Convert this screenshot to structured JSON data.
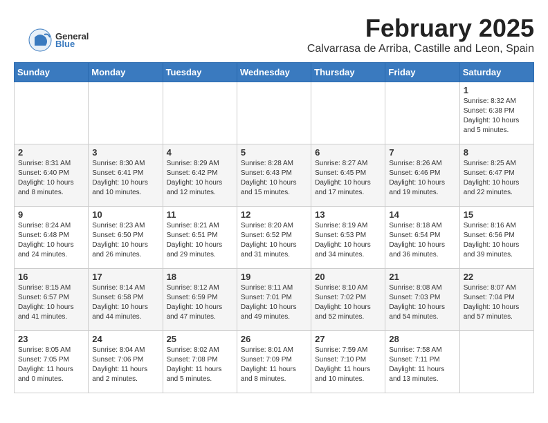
{
  "logo": {
    "general": "General",
    "blue": "Blue"
  },
  "header": {
    "month_year": "February 2025",
    "location": "Calvarrasa de Arriba, Castille and Leon, Spain"
  },
  "weekdays": [
    "Sunday",
    "Monday",
    "Tuesday",
    "Wednesday",
    "Thursday",
    "Friday",
    "Saturday"
  ],
  "weeks": [
    {
      "days": [
        {
          "num": "",
          "info": ""
        },
        {
          "num": "",
          "info": ""
        },
        {
          "num": "",
          "info": ""
        },
        {
          "num": "",
          "info": ""
        },
        {
          "num": "",
          "info": ""
        },
        {
          "num": "",
          "info": ""
        },
        {
          "num": "1",
          "info": "Sunrise: 8:32 AM\nSunset: 6:38 PM\nDaylight: 10 hours and 5 minutes."
        }
      ]
    },
    {
      "days": [
        {
          "num": "2",
          "info": "Sunrise: 8:31 AM\nSunset: 6:40 PM\nDaylight: 10 hours and 8 minutes."
        },
        {
          "num": "3",
          "info": "Sunrise: 8:30 AM\nSunset: 6:41 PM\nDaylight: 10 hours and 10 minutes."
        },
        {
          "num": "4",
          "info": "Sunrise: 8:29 AM\nSunset: 6:42 PM\nDaylight: 10 hours and 12 minutes."
        },
        {
          "num": "5",
          "info": "Sunrise: 8:28 AM\nSunset: 6:43 PM\nDaylight: 10 hours and 15 minutes."
        },
        {
          "num": "6",
          "info": "Sunrise: 8:27 AM\nSunset: 6:45 PM\nDaylight: 10 hours and 17 minutes."
        },
        {
          "num": "7",
          "info": "Sunrise: 8:26 AM\nSunset: 6:46 PM\nDaylight: 10 hours and 19 minutes."
        },
        {
          "num": "8",
          "info": "Sunrise: 8:25 AM\nSunset: 6:47 PM\nDaylight: 10 hours and 22 minutes."
        }
      ]
    },
    {
      "days": [
        {
          "num": "9",
          "info": "Sunrise: 8:24 AM\nSunset: 6:48 PM\nDaylight: 10 hours and 24 minutes."
        },
        {
          "num": "10",
          "info": "Sunrise: 8:23 AM\nSunset: 6:50 PM\nDaylight: 10 hours and 26 minutes."
        },
        {
          "num": "11",
          "info": "Sunrise: 8:21 AM\nSunset: 6:51 PM\nDaylight: 10 hours and 29 minutes."
        },
        {
          "num": "12",
          "info": "Sunrise: 8:20 AM\nSunset: 6:52 PM\nDaylight: 10 hours and 31 minutes."
        },
        {
          "num": "13",
          "info": "Sunrise: 8:19 AM\nSunset: 6:53 PM\nDaylight: 10 hours and 34 minutes."
        },
        {
          "num": "14",
          "info": "Sunrise: 8:18 AM\nSunset: 6:54 PM\nDaylight: 10 hours and 36 minutes."
        },
        {
          "num": "15",
          "info": "Sunrise: 8:16 AM\nSunset: 6:56 PM\nDaylight: 10 hours and 39 minutes."
        }
      ]
    },
    {
      "days": [
        {
          "num": "16",
          "info": "Sunrise: 8:15 AM\nSunset: 6:57 PM\nDaylight: 10 hours and 41 minutes."
        },
        {
          "num": "17",
          "info": "Sunrise: 8:14 AM\nSunset: 6:58 PM\nDaylight: 10 hours and 44 minutes."
        },
        {
          "num": "18",
          "info": "Sunrise: 8:12 AM\nSunset: 6:59 PM\nDaylight: 10 hours and 47 minutes."
        },
        {
          "num": "19",
          "info": "Sunrise: 8:11 AM\nSunset: 7:01 PM\nDaylight: 10 hours and 49 minutes."
        },
        {
          "num": "20",
          "info": "Sunrise: 8:10 AM\nSunset: 7:02 PM\nDaylight: 10 hours and 52 minutes."
        },
        {
          "num": "21",
          "info": "Sunrise: 8:08 AM\nSunset: 7:03 PM\nDaylight: 10 hours and 54 minutes."
        },
        {
          "num": "22",
          "info": "Sunrise: 8:07 AM\nSunset: 7:04 PM\nDaylight: 10 hours and 57 minutes."
        }
      ]
    },
    {
      "days": [
        {
          "num": "23",
          "info": "Sunrise: 8:05 AM\nSunset: 7:05 PM\nDaylight: 11 hours and 0 minutes."
        },
        {
          "num": "24",
          "info": "Sunrise: 8:04 AM\nSunset: 7:06 PM\nDaylight: 11 hours and 2 minutes."
        },
        {
          "num": "25",
          "info": "Sunrise: 8:02 AM\nSunset: 7:08 PM\nDaylight: 11 hours and 5 minutes."
        },
        {
          "num": "26",
          "info": "Sunrise: 8:01 AM\nSunset: 7:09 PM\nDaylight: 11 hours and 8 minutes."
        },
        {
          "num": "27",
          "info": "Sunrise: 7:59 AM\nSunset: 7:10 PM\nDaylight: 11 hours and 10 minutes."
        },
        {
          "num": "28",
          "info": "Sunrise: 7:58 AM\nSunset: 7:11 PM\nDaylight: 11 hours and 13 minutes."
        },
        {
          "num": "",
          "info": ""
        }
      ]
    }
  ]
}
